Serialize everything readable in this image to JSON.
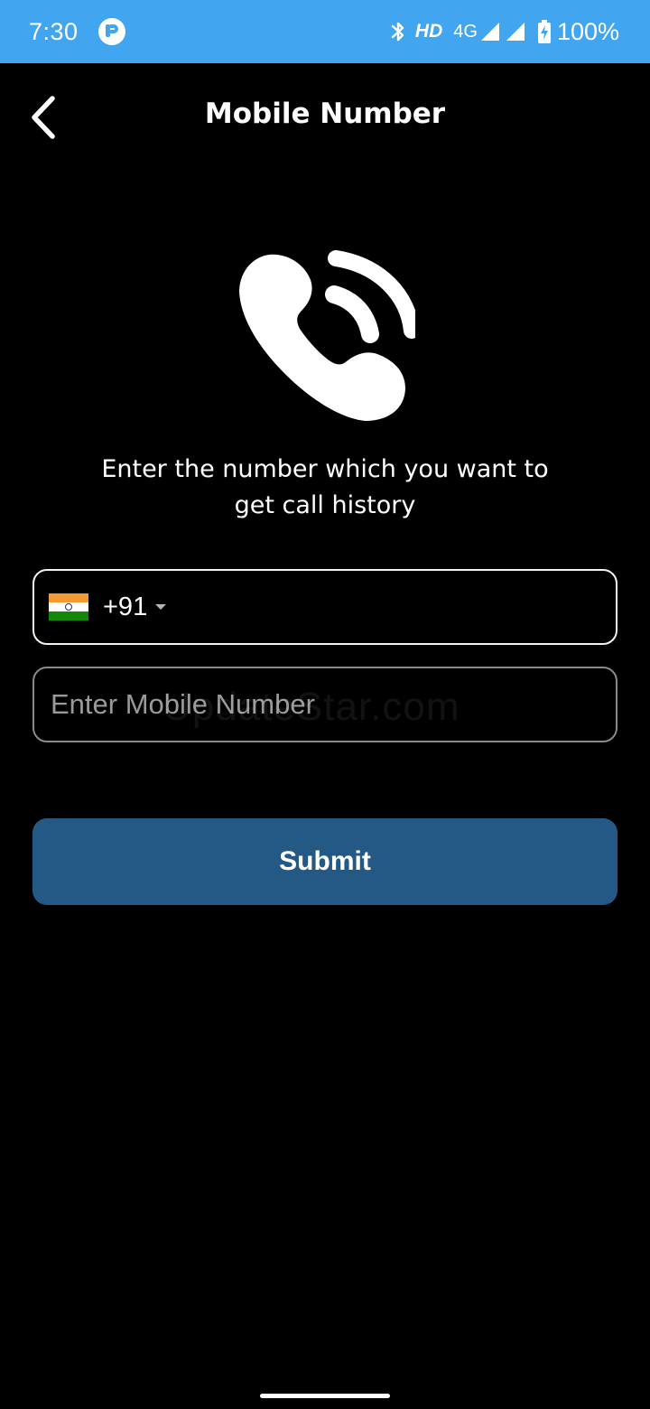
{
  "status_bar": {
    "time": "7:30",
    "hd_label": "HD",
    "network_label": "4G",
    "battery_text": "100%",
    "background_color": "#42a5f0"
  },
  "header": {
    "title": "Mobile Number",
    "back_icon": "chevron-left-icon"
  },
  "illustration": {
    "icon": "phone-call-icon"
  },
  "instruction": {
    "line1": "Enter the number which you want to",
    "line2": "get call history"
  },
  "country_selector": {
    "flag": "india-flag-icon",
    "flag_colors": [
      "#f49a32",
      "#ffffff",
      "#138808"
    ],
    "dial_code": "+91",
    "dropdown_icon": "caret-down-icon"
  },
  "mobile_input": {
    "value": "",
    "placeholder": "Enter Mobile Number"
  },
  "watermark": {
    "text": "UpdateStar.com"
  },
  "submit": {
    "label": "Submit",
    "color": "#245985"
  }
}
